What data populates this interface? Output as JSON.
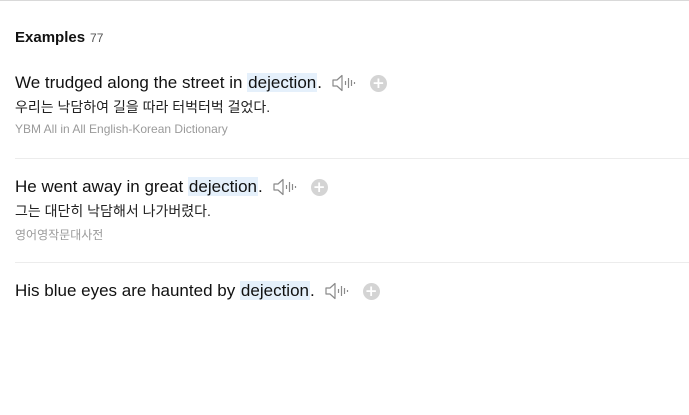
{
  "header": {
    "title": "Examples",
    "count": "77"
  },
  "examples": [
    {
      "before": "We trudged along the street in ",
      "keyword": "dejection",
      "after": ".",
      "translation": "우리는 낙담하여 길을 따라 터벅터벅 걸었다.",
      "source": "YBM All in All English-Korean Dictionary"
    },
    {
      "before": "He went away in great ",
      "keyword": "dejection",
      "after": ".",
      "translation": "그는 대단히 낙담해서 나가버렸다.",
      "source": "영어영작문대사전"
    },
    {
      "before": "His blue eyes are haunted by ",
      "keyword": "dejection",
      "after": "."
    }
  ],
  "icons": {
    "speaker": "speaker-icon",
    "add": "add-icon"
  },
  "colors": {
    "highlight": "#e5f0fb",
    "source_text": "#9a9a9a",
    "add_button": "#d4d4d4"
  }
}
